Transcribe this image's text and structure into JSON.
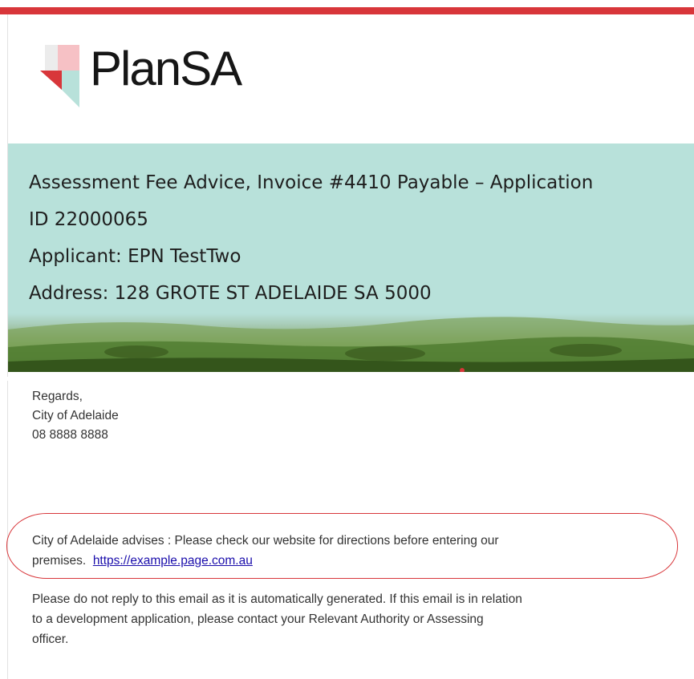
{
  "brand": {
    "logo_text": "PlanSA",
    "colors": {
      "accent_red": "#d8363a",
      "pink": "#f6c1c5",
      "mint": "#b8e1da",
      "dark": "#161616"
    }
  },
  "banner": {
    "title_line1": "Assessment Fee Advice, Invoice #4410 Payable – Application",
    "title_line2": "ID 22000065",
    "applicant": "Applicant: EPN TestTwo",
    "address": "Address: 128 GROTE ST ADELAIDE SA 5000"
  },
  "signature": {
    "regards": "Regards,",
    "org": "City of Adelaide",
    "phone": "08 8888 8888"
  },
  "notice": {
    "text_line1": "City of Adelaide advises : Please check our website for directions before entering our",
    "text_line2_prefix": "premises.",
    "link": "https://example.page.com.au"
  },
  "footer": {
    "line1": "Please do not reply to this email as it is automatically generated. If this email is in relation",
    "line2": "to a development application, please contact your Relevant Authority or Assessing",
    "line3": "officer."
  }
}
